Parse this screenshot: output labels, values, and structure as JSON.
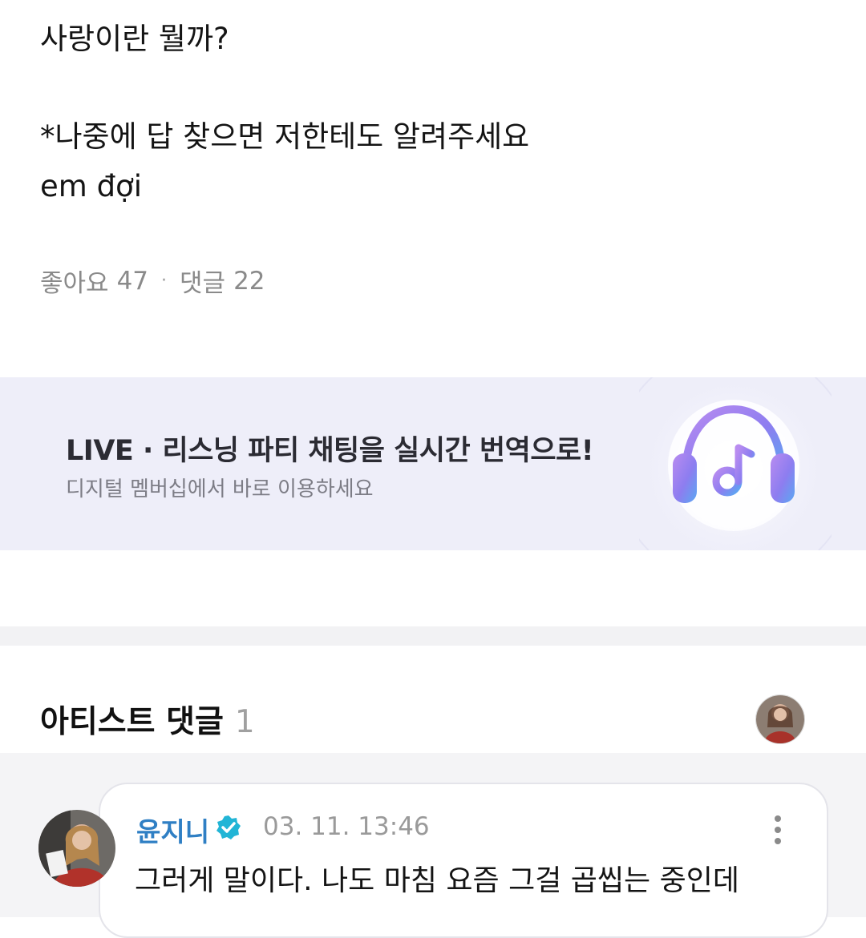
{
  "post": {
    "lines": [
      "사랑이란 뭘까?",
      "*나중에 답 찾으면 저한테도 알려주세요",
      "em đợi"
    ],
    "likes_label": "좋아요",
    "likes_count": "47",
    "separator": "·",
    "comments_label": "댓글",
    "comments_count": "22"
  },
  "banner": {
    "title": "LIVE · 리스닝 파티 채팅을 실시간 번역으로!",
    "subtitle": "디지털 멤버십에서 바로 이용하세요",
    "icon": "headphones-music-icon"
  },
  "artist_comments": {
    "title": "아티스트 댓글",
    "count": "1",
    "avatar_icon": "artist-avatar"
  },
  "comment": {
    "author": "윤지니",
    "verified_icon": "verified-badge-icon",
    "time": "03. 11. 13:46",
    "text": "그러게 말이다. 나도 마침 요즘 그걸 곱씹는 중인데",
    "menu_icon": "more-vertical-icon"
  },
  "colors": {
    "author": "#2f7fc4",
    "verified": "#22b5d6",
    "banner_bg": "#eeeef9"
  }
}
